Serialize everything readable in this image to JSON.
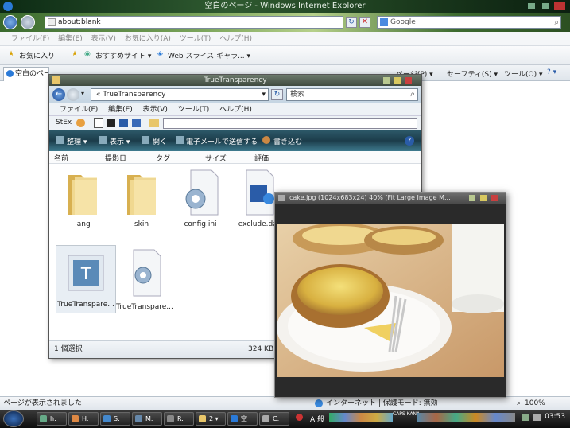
{
  "ie": {
    "title": "空白のページ - Windows Internet Explorer",
    "address": "about:blank",
    "search_placeholder": "Google",
    "menu": [
      "ファイル(F)",
      "編集(E)",
      "表示(V)",
      "お気に入り(A)",
      "ツール(T)",
      "ヘルプ(H)"
    ],
    "favorites_label": "お気に入り",
    "suggested_sites": "おすすめサイト ▾",
    "web_slice": "Web スライス ギャラ... ▾",
    "tab_label": "空白のペー",
    "page_menu": "ページ(P) ▾",
    "safety_menu": "セーフティ(S) ▾",
    "tools_menu": "ツール(O) ▾",
    "help_icon": "? ▾",
    "status_text": "ページが表示されました",
    "zone_text": "インターネット | 保護モード: 無効",
    "zoom": "100%"
  },
  "explorer": {
    "title": "TrueTransparency",
    "address": "« TrueTransparency",
    "search_placeholder": "検索",
    "menu": [
      "ファイル(F)",
      "編集(E)",
      "表示(V)",
      "ツール(T)",
      "ヘルプ(H)"
    ],
    "stex_label": "StEx",
    "commands": [
      "整理 ▾",
      "表示 ▾",
      "開く",
      "電子メールで送信する",
      "書き込む"
    ],
    "columns": [
      "名前",
      "撮影日",
      "タグ",
      "サイズ",
      "評価"
    ],
    "items": [
      {
        "label": "lang",
        "icon": "folder-icon"
      },
      {
        "label": "skin",
        "icon": "folder-icon"
      },
      {
        "label": "config.ini",
        "icon": "settings-file-icon"
      },
      {
        "label": "exclude.dat",
        "icon": "media-file-icon"
      },
      {
        "label": "TrueTranspare...",
        "icon": "app-icon"
      },
      {
        "label": "TrueTranspare...",
        "icon": "settings-file-icon"
      }
    ],
    "status_selected": "1 個選択",
    "status_size": "324 KB"
  },
  "viewer": {
    "title": "cake.jpg  (1024x683x24) 40% (Fit Large Image M..."
  },
  "taskbar": {
    "buttons": [
      "h.",
      "H.",
      "S.",
      "M.",
      "R.",
      "2 ▾",
      "空",
      "C."
    ],
    "ime": "A 般",
    "caps": "CAPS KANA",
    "clock": "03:53"
  },
  "colors": {
    "accent": "#2a5ca8",
    "folder": "#e8c66a",
    "explorer_cmd": "#1c3c4a"
  }
}
